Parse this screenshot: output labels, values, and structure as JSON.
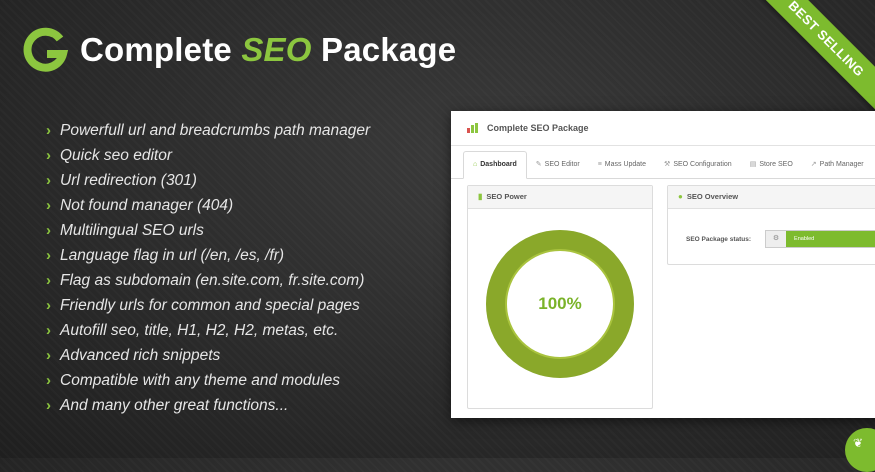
{
  "header": {
    "title_part1": "Complete",
    "title_accent": "SEO",
    "title_part2": "Package"
  },
  "ribbon": {
    "label": "BEST SELLING"
  },
  "features": [
    "Powerfull url and breadcrumbs path manager",
    "Quick seo editor",
    "Url redirection (301)",
    "Not found manager (404)",
    "Multilingual SEO urls",
    "Language flag in url (/en, /es, /fr)",
    "Flag as subdomain (en.site.com, fr.site.com)",
    "Friendly urls for common and special pages",
    "Autofill seo, title, H1, H2, H2, metas, etc.",
    "Advanced rich snippets",
    "Compatible with any theme and modules",
    "And many other great functions..."
  ],
  "window": {
    "title": "Complete SEO Package",
    "tabs": [
      "Dashboard",
      "SEO Editor",
      "Mass Update",
      "SEO Configuration",
      "Store SEO",
      "Path Manager"
    ],
    "seo_power": {
      "heading": "SEO Power",
      "percent_label": "100%",
      "value": 100
    },
    "overview": {
      "heading": "SEO Overview",
      "status_label": "SEO Package status:",
      "status_value": "Enabled"
    }
  },
  "colors": {
    "accent": "#8cc63f",
    "ribbon": "#7dbb2e",
    "donut_outer": "#8aa82a",
    "background": "#2b2b2b"
  }
}
